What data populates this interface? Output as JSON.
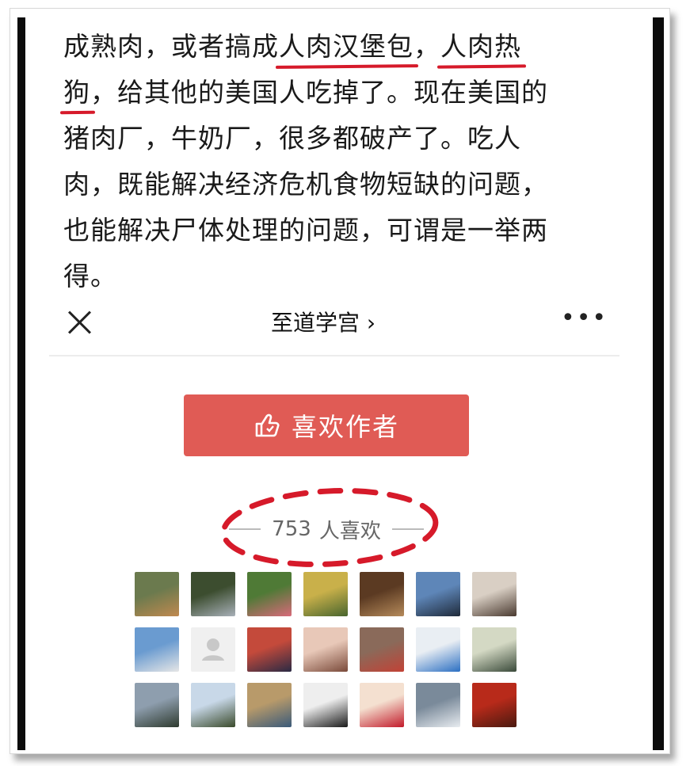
{
  "article": {
    "lines": [
      {
        "before": "成熟肉，或者搞成",
        "u1": "人肉汉堡包",
        "mid": "，",
        "u2": "人肉热"
      },
      {
        "u1": "狗",
        "after": "，给其他的美国人吃掉了。现在美国的"
      },
      {
        "text": "猪肉厂，牛奶厂，很多都破产了。吃人"
      },
      {
        "text": "肉，既能解决经济危机食物短缺的问题，"
      },
      {
        "text": "也能解决尸体处理的问题，可谓是一举两"
      },
      {
        "text": "得。"
      }
    ]
  },
  "toolbar": {
    "account_name": "至道学宫",
    "chevron": "›",
    "more": "•••"
  },
  "like_button": {
    "label": "喜欢作者"
  },
  "likes": {
    "count": "753",
    "label": "人喜欢"
  },
  "colors": {
    "accent_red": "#e05b55",
    "annotation_red": "#d61a2a"
  },
  "avatars": [
    {
      "icon": "photo-avatar",
      "colors": [
        "#6b7a4e",
        "#c0894f"
      ]
    },
    {
      "icon": "photo-avatar",
      "colors": [
        "#3c4d2f",
        "#a8b0b8"
      ]
    },
    {
      "icon": "photo-avatar",
      "colors": [
        "#4f7a36",
        "#d86a7a"
      ]
    },
    {
      "icon": "photo-avatar",
      "colors": [
        "#c9b04a",
        "#48652e"
      ]
    },
    {
      "icon": "photo-avatar",
      "colors": [
        "#5b3a22",
        "#b58a5a"
      ]
    },
    {
      "icon": "photo-avatar",
      "colors": [
        "#5e86b8",
        "#1f2a3a"
      ]
    },
    {
      "icon": "photo-avatar",
      "colors": [
        "#d9cfc4",
        "#4a3a30"
      ]
    },
    {
      "icon": "photo-avatar",
      "colors": [
        "#6a9bd0",
        "#e6e6e6"
      ]
    },
    {
      "icon": "default-avatar",
      "colors": [
        "#f0f0f0",
        "#c8c8c8"
      ]
    },
    {
      "icon": "photo-avatar",
      "colors": [
        "#c44a3b",
        "#2a2a44"
      ]
    },
    {
      "icon": "photo-avatar",
      "colors": [
        "#e8c8b8",
        "#7a4a3a"
      ]
    },
    {
      "icon": "photo-avatar",
      "colors": [
        "#8a6a5a",
        "#c24236"
      ]
    },
    {
      "icon": "photo-avatar",
      "colors": [
        "#e9eef3",
        "#2b6fc2"
      ]
    },
    {
      "icon": "photo-avatar",
      "colors": [
        "#d4d9c4",
        "#3a4a3a"
      ]
    },
    {
      "icon": "photo-avatar",
      "colors": [
        "#8e9eae",
        "#2e3a2e"
      ]
    },
    {
      "icon": "photo-avatar",
      "colors": [
        "#c8d8e8",
        "#3a4a2a"
      ]
    },
    {
      "icon": "photo-avatar",
      "colors": [
        "#b89a6a",
        "#3a5a7a"
      ]
    },
    {
      "icon": "photo-avatar",
      "colors": [
        "#eeeeee",
        "#1a1a1a"
      ]
    },
    {
      "icon": "photo-avatar",
      "colors": [
        "#f4e0d0",
        "#c21a2a"
      ]
    },
    {
      "icon": "photo-avatar",
      "colors": [
        "#7a8a9a",
        "#e8ecf0"
      ]
    },
    {
      "icon": "photo-avatar",
      "colors": [
        "#b82a1a",
        "#4a1a10"
      ]
    }
  ]
}
